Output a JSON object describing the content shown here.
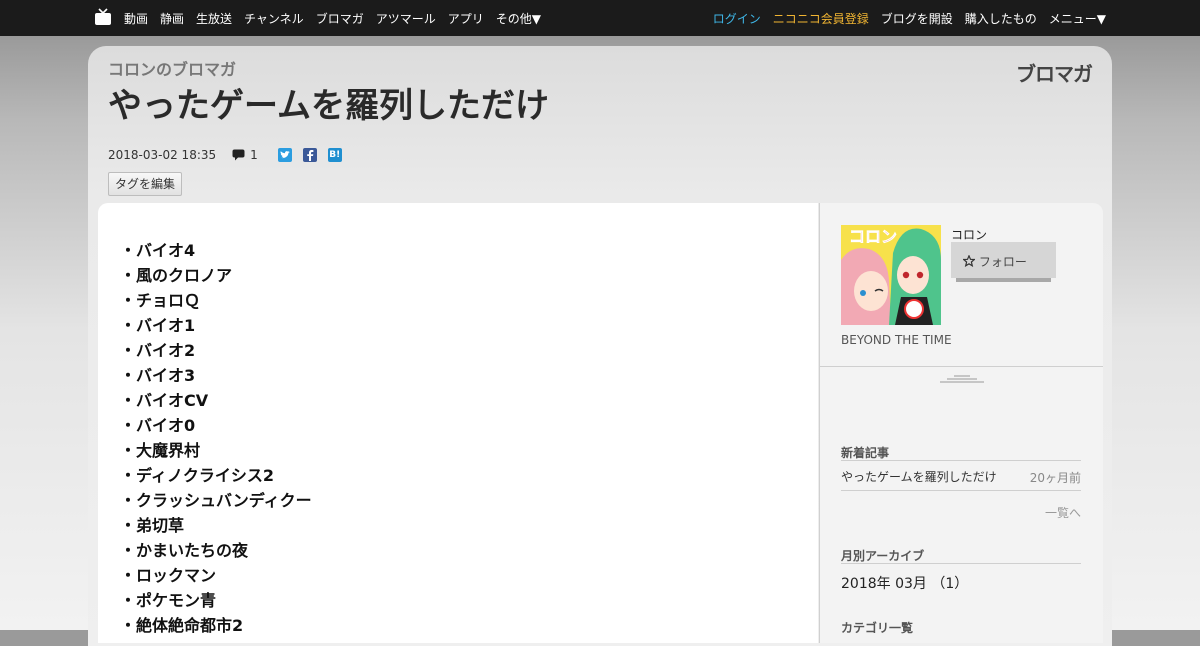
{
  "nav": {
    "left": [
      "動画",
      "静画",
      "生放送",
      "チャンネル",
      "ブロマガ",
      "アツマール",
      "アプリ",
      "その他▼"
    ],
    "login": "ログイン",
    "register": "ニコニコ会員登録",
    "open_blog": "ブログを開設",
    "purchased": "購入したもの",
    "menu": "メニュー▼"
  },
  "header": {
    "blog_name": "コロンのブロマガ",
    "brand": "ブロマガ",
    "title": "やったゲームを羅列しただけ",
    "datetime": "2018-03-02 18:35",
    "comment_count": "1",
    "share": {
      "twitter": "twitter-icon",
      "facebook": "facebook-icon",
      "hatena": "B!"
    },
    "tag_edit": "タグを編集"
  },
  "article": {
    "games": [
      "・バイオ4",
      "・風のクロノア",
      "・チョロＱ",
      "・バイオ1",
      "・バイオ2",
      "・バイオ3",
      "・バイオCV",
      "・バイオ0",
      "・大魔界村",
      "・ディノクライシス2",
      "・クラッシュバンディクー",
      "・弟切草",
      "・かまいたちの夜",
      "・ロックマン",
      "・ポケモン青",
      "・絶体絶命都市2"
    ]
  },
  "sidebar": {
    "avatar_text": "コロン",
    "user_name": "コロン",
    "follow_label": "フォロー",
    "description": "BEYOND THE TIME",
    "recent_heading": "新着記事",
    "recent_items": [
      {
        "title": "やったゲームを羅列しただけ",
        "time": "20ヶ月前"
      }
    ],
    "more_label": "一覧へ",
    "archive_heading": "月別アーカイブ",
    "archive_items": [
      "2018年 03月 （1）"
    ],
    "category_heading": "カテゴリ一覧"
  },
  "colors": {
    "login": "#3fb7e8",
    "register": "#f0b432",
    "twitter": "#2b9de0",
    "facebook": "#3b5998",
    "hatena": "#1f8fd0"
  }
}
